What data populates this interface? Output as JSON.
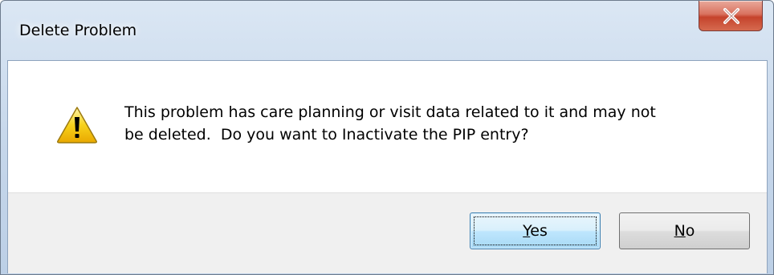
{
  "window": {
    "title": "Delete Problem",
    "close_icon": "close-x-icon"
  },
  "dialog": {
    "icon": "warning-icon",
    "message_line1": "This problem has care planning or visit data related to it and may not",
    "message_line2": "be deleted.  Do you want to Inactivate the PIP entry?"
  },
  "buttons": {
    "yes": {
      "mnemonic": "Y",
      "rest": "es"
    },
    "no": {
      "mnemonic": "N",
      "rest": "o"
    }
  },
  "colors": {
    "close_button": "#c5432c",
    "warning_yellow": "#f5c400",
    "default_button_border": "#3c7fb1"
  }
}
